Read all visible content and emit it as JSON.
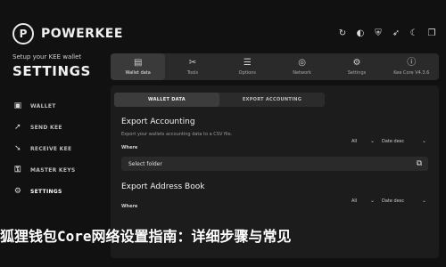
{
  "sidebar": {
    "brand_name": "POWERKEE",
    "brand_logo_letter": "P",
    "setup_text": "Setup your KEE wallet",
    "settings_title": "SETTINGS",
    "items": [
      {
        "label": "WALLET",
        "icon": "wallet-icon"
      },
      {
        "label": "SEND KEE",
        "icon": "send-icon"
      },
      {
        "label": "RECEIVE KEE",
        "icon": "receive-icon"
      },
      {
        "label": "MASTER KEYS",
        "icon": "key-icon"
      },
      {
        "label": "SETTINGS",
        "icon": "gear-icon"
      }
    ]
  },
  "header": {
    "icons": [
      "refresh-icon",
      "contrast-icon",
      "shield-icon",
      "rocket-icon",
      "moon-icon",
      "copy-icon"
    ]
  },
  "tabs": [
    {
      "label": "Wallet data",
      "icon": "wallet-icon"
    },
    {
      "label": "Tools",
      "icon": "tools-icon"
    },
    {
      "label": "Options",
      "icon": "sliders-icon"
    },
    {
      "label": "Network",
      "icon": "network-icon"
    },
    {
      "label": "Settings",
      "icon": "settings-icon"
    },
    {
      "label": "Kee Core V4.3.6",
      "icon": "info-icon"
    }
  ],
  "subtabs": [
    {
      "label": "WALLET DATA"
    },
    {
      "label": "EXPORT ACCOUNTING"
    }
  ],
  "export_accounting": {
    "title": "Export Accounting",
    "description": "Export your wallets accounting data to a CSV file.",
    "where_label": "Where",
    "filter_all": "All",
    "sort": "Date desc",
    "folder_value": "Select folder"
  },
  "export_address_book": {
    "title": "Export Address Book",
    "where_label": "Where",
    "filter_all": "All",
    "sort": "Date desc"
  },
  "overlay_text": "狐狸钱包Core网络设置指南：详细步骤与常见"
}
